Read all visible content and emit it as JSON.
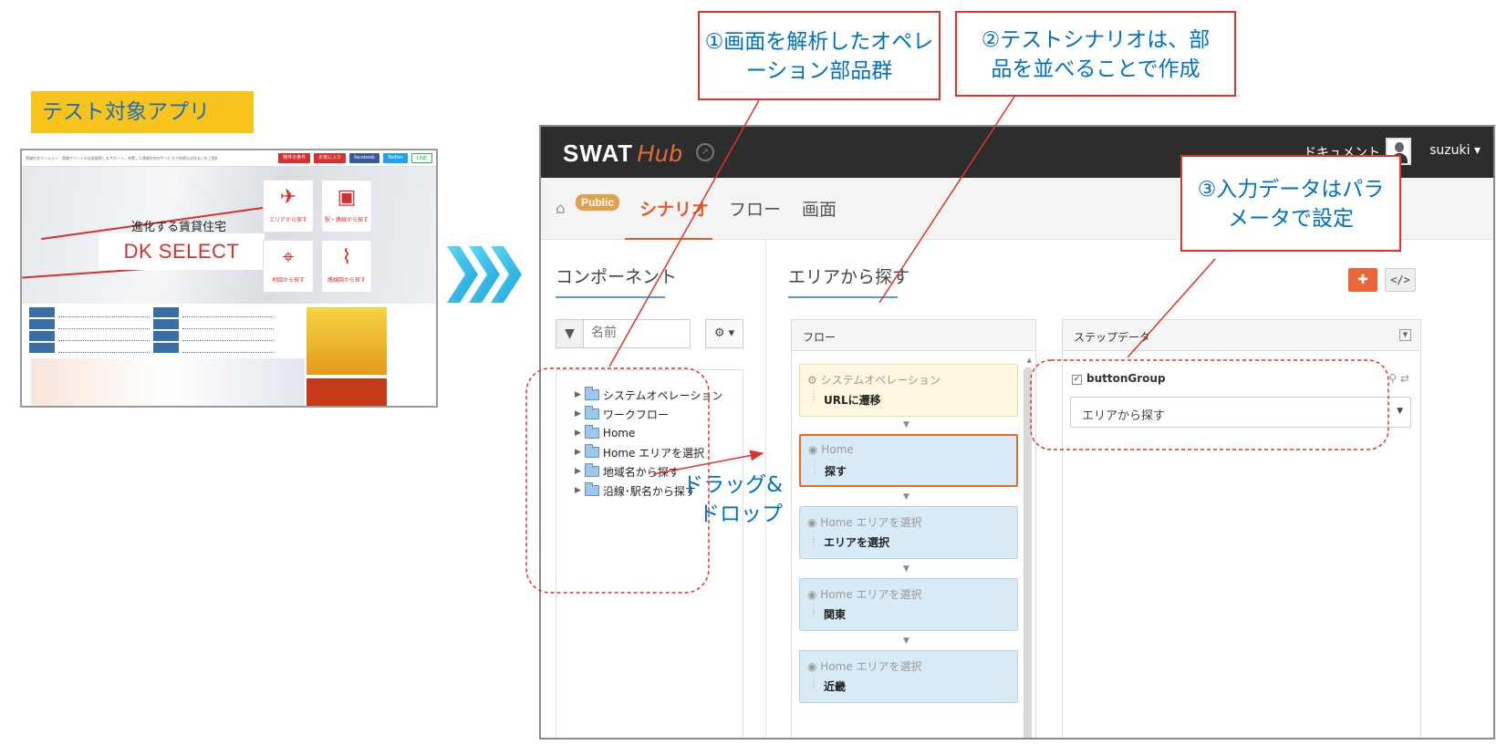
{
  "target_app": {
    "label": "テスト対象アプリ",
    "header_text": "賃貸住宅マンション・賃貸アパートのお部屋探しをサポート。充実した賃貸住宅のサービスで快適なお住まいをご提供します。",
    "header_pills": [
      "物件の条件",
      "お気に入り",
      "facebook",
      "Twitter",
      "LINE"
    ],
    "hero_subtitle": "進化する賃貸住宅",
    "logo": "DK SELECT",
    "tiles": [
      {
        "label": "エリアから探す"
      },
      {
        "label": "駅・路線から探す"
      },
      {
        "label": "地図から探す"
      },
      {
        "label": "路線図から探す"
      }
    ]
  },
  "callouts": {
    "c1": "①画面を解析したオペレーション部品群",
    "c2": "②テストシナリオは、部品を並べることで作成",
    "c3": "③入力データはパラメータで設定"
  },
  "drag_drop_label": "ドラッグ&ドロップ",
  "app": {
    "brand": "SWAT",
    "brand_hub": "Hub",
    "doc_link": "ドキュメント",
    "user": "suzuki ▾",
    "public_badge": "Public",
    "tabs": [
      "シナリオ",
      "フロー",
      "画面"
    ],
    "active_tab": "シナリオ",
    "components_title": "コンポーネント",
    "filter_placeholder": "名前",
    "tree": [
      "システムオペレーション",
      "ワークフロー",
      "Home",
      "Home エリアを選択",
      "地域名から探す",
      "沿線･駅名から探す"
    ],
    "scenario_title": "エリアから探す",
    "flow_panel_title": "フロー",
    "steps": [
      {
        "sub": "システムオペレーション",
        "main": "URLに遷移",
        "kind": "sys"
      },
      {
        "sub": "Home",
        "main": "探す",
        "kind": "selected"
      },
      {
        "sub": "Home エリアを選択",
        "main": "エリアを選択",
        "kind": "normal"
      },
      {
        "sub": "Home エリアを選択",
        "main": "関東",
        "kind": "normal"
      },
      {
        "sub": "Home エリアを選択",
        "main": "近畿",
        "kind": "normal"
      }
    ],
    "step_data_title": "ステップデータ",
    "field_name": "buttonGroup",
    "field_value": "エリアから探す"
  },
  "colors": {
    "accent_orange": "#e05b2a",
    "callout_border": "#e0332f",
    "callout_text": "#0070c0",
    "topbar": "#2d2d2d",
    "label_yellow": "#f8c31c"
  }
}
